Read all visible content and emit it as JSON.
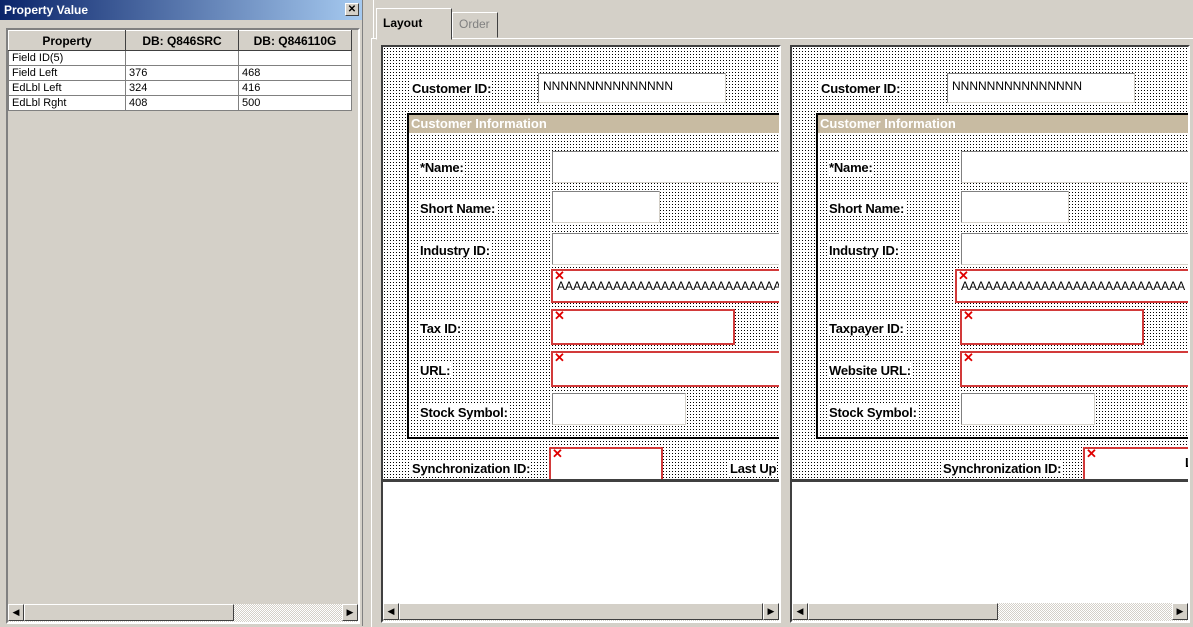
{
  "property_panel": {
    "title": "Property Value",
    "headers": [
      "Property",
      "DB: Q846SRC",
      "DB: Q846110G"
    ],
    "rows": [
      {
        "name": "Field ID(5)",
        "v1": "",
        "v2": ""
      },
      {
        "name": "Field Left",
        "v1": "376",
        "v2": "468"
      },
      {
        "name": "EdLbl Left",
        "v1": "324",
        "v2": "416"
      },
      {
        "name": "EdLbl Rght",
        "v1": "408",
        "v2": "500"
      }
    ]
  },
  "tabs": {
    "layout": "Layout",
    "order": "Order"
  },
  "left_form": {
    "customer_id_label": "Customer ID:",
    "customer_id_value": "NNNNNNNNNNNNNNN",
    "group_title": "Customer Information",
    "name_label": "*Name:",
    "short_name_label": "Short Name:",
    "industry_label": "Industry ID:",
    "industry_desc": "AAAAAAAAAAAAAAAAAAAAAAAAAAAA",
    "tax_label": "Tax ID:",
    "url_label": "URL:",
    "stock_label": "Stock Symbol:",
    "sync_label": "Synchronization ID:",
    "last_label": "Last Up"
  },
  "right_form": {
    "customer_id_label": "Customer ID:",
    "customer_id_value": "NNNNNNNNNNNNNNN",
    "group_title": "Customer Information",
    "name_label": "*Name:",
    "short_name_label": "Short Name:",
    "industry_label": "Industry ID:",
    "industry_desc": "AAAAAAAAAAAAAAAAAAAAAAAAAAAA",
    "tax_label": "Taxpayer ID:",
    "url_label": "Website URL:",
    "stock_label": "Stock Symbol:",
    "sync_label": "Synchronization ID:",
    "last_label": "L"
  },
  "icons": {
    "scroll_left": "◀",
    "scroll_right": "▶",
    "close": "✕",
    "error_mark": "✕"
  }
}
